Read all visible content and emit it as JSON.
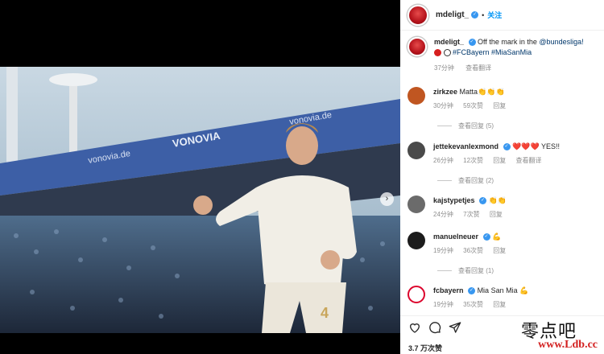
{
  "post": {
    "username": "mdeligt_",
    "follow_label": "关注",
    "dot": "•",
    "caption_prefix": "Off the mark in the ",
    "caption_link": "@bundesliga!",
    "caption_tags": "#FCBayern #MiaSanMia",
    "time": "37分钟",
    "translate": "查看翻译",
    "likes": "3.7 万次赞"
  },
  "photo": {
    "banner_text_1": "vonovia.de",
    "banner_text_2": "VONOVIA",
    "jersey_number": "4",
    "colors": {
      "sky": "#a9c2d3",
      "roof": "#3e5ea8",
      "crowd": "#2b3950",
      "jersey": "#f1eee6"
    }
  },
  "comments": [
    {
      "user": "zirkzee",
      "verified": false,
      "text": "Matta👏👏👏",
      "time": "30分钟",
      "likes": "59次赞",
      "reply": "回复",
      "replies": "查看回复 (5)",
      "avatar_color": "#c05621"
    },
    {
      "user": "jettekevanlexmond",
      "verified": true,
      "text": "❤️❤️❤️ YES!!",
      "time": "26分钟",
      "likes": "12次赞",
      "reply": "回复",
      "translate": "查看翻译",
      "replies": "查看回复 (2)",
      "avatar_color": "#4a4a4a"
    },
    {
      "user": "kajstypetjes",
      "verified": true,
      "text": "👏👏",
      "time": "24分钟",
      "likes": "7次赞",
      "reply": "回复",
      "replies": "",
      "avatar_color": "#6b6b6b"
    },
    {
      "user": "manuelneuer",
      "verified": true,
      "text": "💪",
      "time": "19分钟",
      "likes": "36次赞",
      "reply": "回复",
      "replies": "查看回复 (1)",
      "avatar_color": "#1c1c1c"
    },
    {
      "user": "fcbayern",
      "verified": true,
      "text": "Mia San Mia 💪",
      "time": "19分钟",
      "likes": "35次赞",
      "reply": "回复",
      "replies": "",
      "avatar_color": "#dc052d"
    }
  ],
  "watermark": {
    "cn": "零点吧",
    "url": "www.Ldb.cc"
  }
}
